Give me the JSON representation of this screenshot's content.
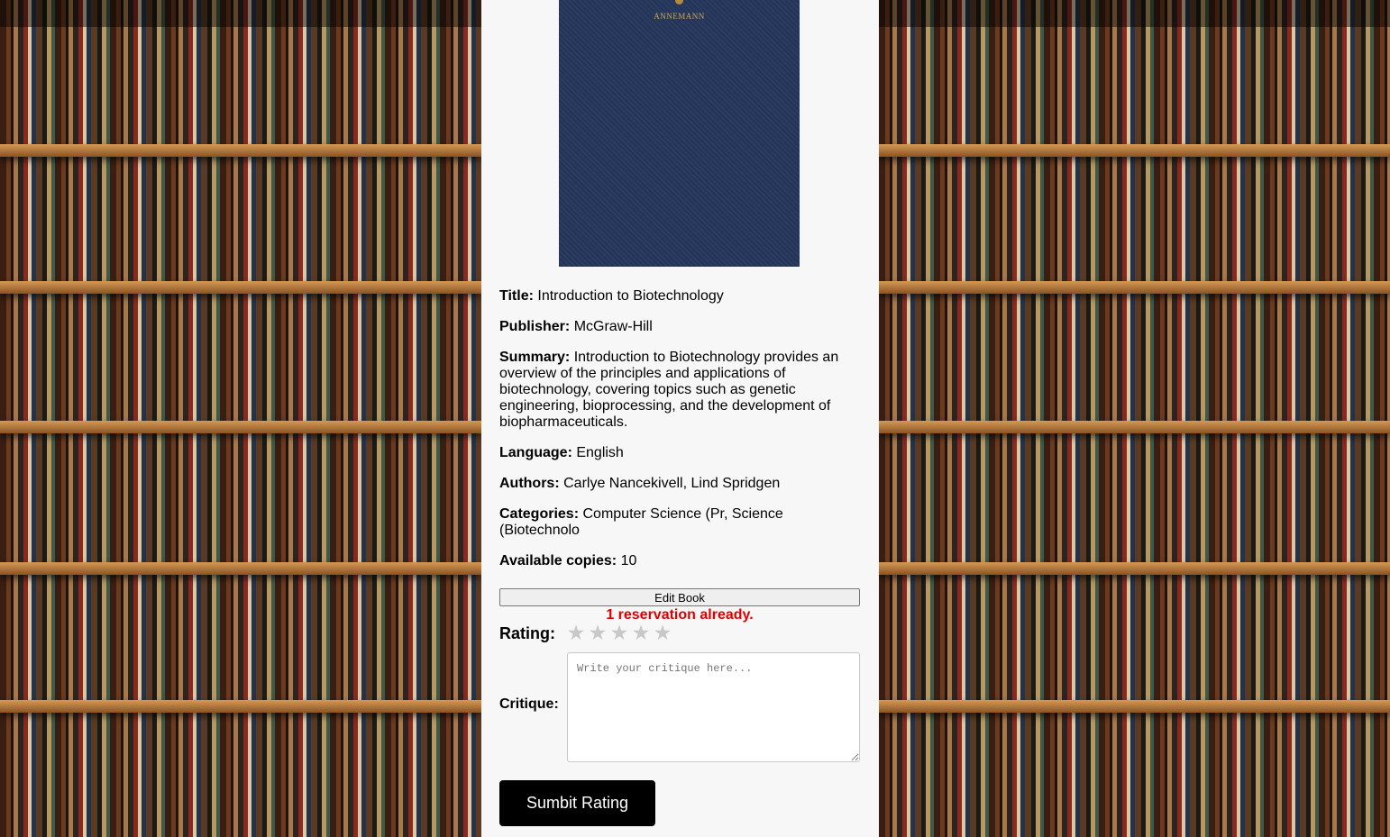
{
  "cover": {
    "author_text": "ANNEMANN"
  },
  "book": {
    "title_label": "Title:",
    "title": "Introduction to Biotechnology",
    "publisher_label": "Publisher:",
    "publisher": "McGraw-Hill",
    "summary_label": "Summary:",
    "summary": "Introduction to Biotechnology provides an overview of the principles and applications of biotechnology, covering topics such as genetic engineering, bioprocessing, and the development of biopharmaceuticals.",
    "language_label": "Language:",
    "language": "English",
    "authors_label": "Authors:",
    "authors": "Carlye Nancekivell, Lind Spridgen",
    "categories_label": "Categories:",
    "categories": "Computer Science (Pr, Science (Biotechnolo",
    "copies_label": "Available copies:",
    "copies": "10"
  },
  "actions": {
    "edit_label": "Edit Book",
    "reservation_notice": "1 reservation already.",
    "rating_label": "Rating:",
    "stars": [
      "★",
      "★",
      "★",
      "★",
      "★"
    ],
    "critique_label": "Critique:",
    "critique_placeholder": "Write your critique here...",
    "submit_label": "Sumbit Rating"
  },
  "colors": {
    "notice": "#e00000",
    "cover": "#24365c",
    "star_inactive": "#c8c8c8",
    "submit_bg": "#000000"
  }
}
